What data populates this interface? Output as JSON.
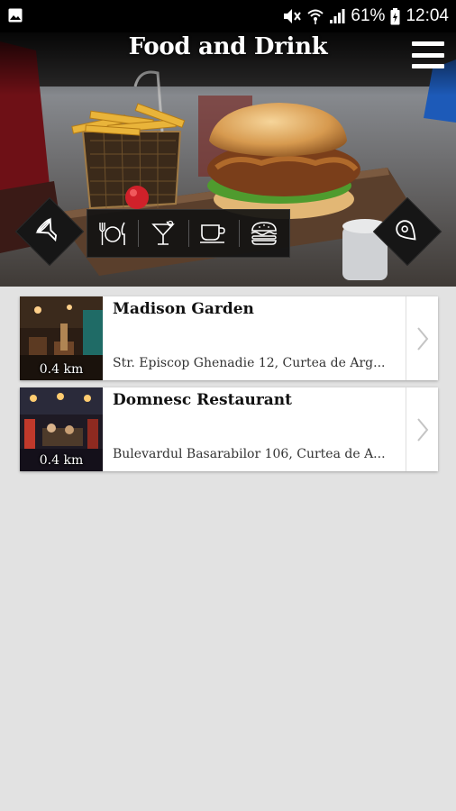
{
  "status": {
    "battery": "61%",
    "time": "12:04",
    "icons": [
      "gallery-icon",
      "mute-icon",
      "wifi-icon",
      "signal-icon",
      "battery-icon"
    ]
  },
  "header": {
    "title": "Food and Drink",
    "menu_icon": "hamburger-menu-icon"
  },
  "filters": {
    "left_icon": "funnel-filter-icon",
    "right_icon": "map-pin-icon",
    "categories": [
      {
        "icon": "fork-plate-knife-icon",
        "label": "Restaurants"
      },
      {
        "icon": "cocktail-icon",
        "label": "Bars"
      },
      {
        "icon": "coffee-cup-icon",
        "label": "Cafes"
      },
      {
        "icon": "burger-icon",
        "label": "Fast food"
      }
    ]
  },
  "places": [
    {
      "name": "Madison Garden",
      "address": "Str. Episcop Ghenadie 12, Curtea de Arg...",
      "distance": "0.4 km"
    },
    {
      "name": "Domnesc Restaurant",
      "address": "Bulevardul Basarabilor 106, Curtea de A...",
      "distance": "0.4 km"
    }
  ],
  "colors": {
    "status_bar": "#000000",
    "background": "#e2e2e2",
    "card": "#ffffff",
    "diamond": "#161616"
  }
}
